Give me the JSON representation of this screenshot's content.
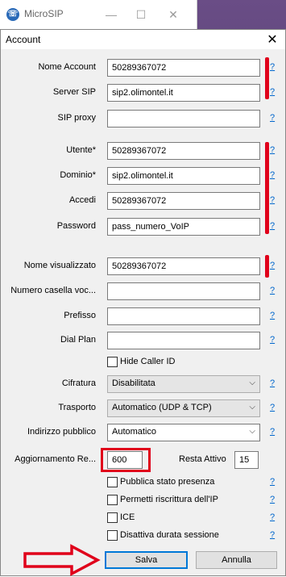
{
  "main_window": {
    "title": "MicroSIP",
    "icon": "microsip-logo-icon"
  },
  "dialog": {
    "title": "Account",
    "close_glyph": "✕"
  },
  "help_text": "?",
  "fields": {
    "account_name": {
      "label": "Nome Account",
      "value": "50289367072"
    },
    "sip_server": {
      "label": "Server SIP",
      "value": "sip2.olimontel.it"
    },
    "sip_proxy": {
      "label": "SIP proxy",
      "value": ""
    },
    "user": {
      "label": "Utente",
      "value": "50289367072"
    },
    "domain": {
      "label": "Dominio",
      "value": "sip2.olimontel.it"
    },
    "login": {
      "label": "Accedi",
      "value": "50289367072"
    },
    "password": {
      "label": "Password",
      "value": "pass_numero_VoIP"
    },
    "display_name": {
      "label": "Nome visualizzato",
      "value": "50289367072"
    },
    "voicemail": {
      "label": "Numero casella voc...",
      "value": ""
    },
    "prefix": {
      "label": "Prefisso",
      "value": ""
    },
    "dial_plan": {
      "label": "Dial Plan",
      "value": ""
    }
  },
  "required_mark": "*",
  "hide_caller_id": {
    "label": "Hide Caller ID",
    "checked": false
  },
  "encryption": {
    "label": "Cifratura",
    "value": "Disabilitata"
  },
  "transport": {
    "label": "Trasporto",
    "value": "Automatico (UDP & TCP)"
  },
  "public_address": {
    "label": "Indirizzo pubblico",
    "value": "Automatico"
  },
  "registration": {
    "label": "Aggiornamento Re...",
    "value": "600"
  },
  "keep_alive": {
    "label": "Resta Attivo",
    "value": "15"
  },
  "checkboxes": [
    {
      "label": "Pubblica stato presenza",
      "checked": false
    },
    {
      "label": "Permetti riscrittura dell'IP",
      "checked": false
    },
    {
      "label": "ICE",
      "checked": false
    },
    {
      "label": "Disattiva durata sessione",
      "checked": false
    }
  ],
  "buttons": {
    "save": "Salva",
    "cancel": "Annulla"
  },
  "annotation_color": "#e0001a"
}
